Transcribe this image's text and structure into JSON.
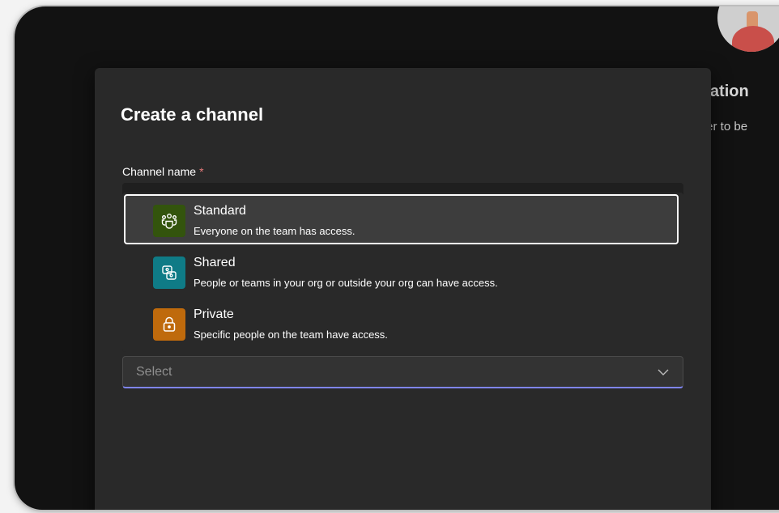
{
  "background": {
    "heading": "rsation",
    "subtext": "icher to be"
  },
  "dialog": {
    "title": "Create a channel",
    "channel_name_label": "Channel name",
    "required_marker": "*",
    "options": [
      {
        "title": "Standard",
        "description": "Everyone on the team has access.",
        "icon": "people-icon",
        "color": "#33540d",
        "selected": true
      },
      {
        "title": "Shared",
        "description": "People or teams in your org or outside your org can have access.",
        "icon": "shared-icon",
        "color": "#0f7b86",
        "selected": false
      },
      {
        "title": "Private",
        "description": "Specific people on the team have access.",
        "icon": "lock-icon",
        "color": "#bf6a0c",
        "selected": false
      }
    ],
    "select": {
      "placeholder": "Select",
      "accent": "#7f85f5"
    }
  }
}
